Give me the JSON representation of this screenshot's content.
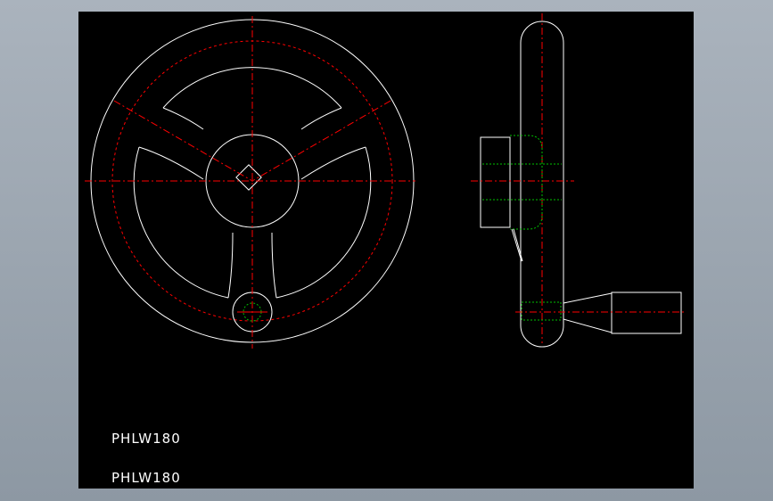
{
  "drawing": {
    "labels": [
      "PHLW180",
      "PHLW180"
    ],
    "colors": {
      "background": "#000000",
      "outline": "#ffffff",
      "centerline": "#ff0000",
      "hidden": "#00c000",
      "frame": "#9aa4ae"
    }
  }
}
